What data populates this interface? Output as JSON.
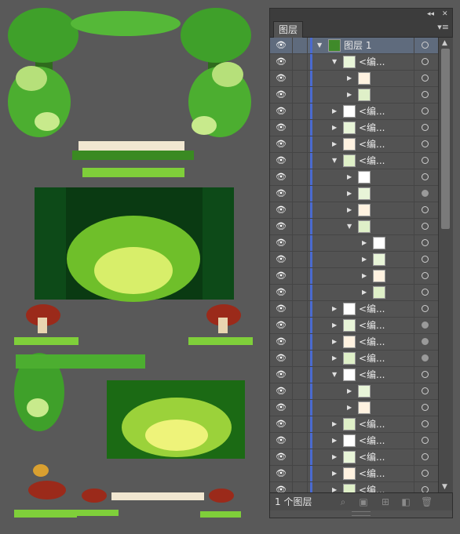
{
  "panel": {
    "collapse_icon": "double-chevron-left-icon",
    "close_icon": "close-icon",
    "tab_label": "图层",
    "menu_icon": "panel-menu-icon",
    "layer_count": "1 个图层",
    "footer_icons": [
      "locate-object-icon",
      "make-clipping-mask-icon",
      "create-sublayer-icon",
      "new-layer-icon",
      "delete-icon"
    ]
  },
  "layers": [
    {
      "label": "图层 1",
      "level": 0,
      "expanded": true,
      "circle": "open",
      "selected": true
    },
    {
      "label": "<编...",
      "level": 1,
      "expanded": true,
      "circle": "open"
    },
    {
      "label": "",
      "level": 2,
      "expanded": false,
      "circle": "open"
    },
    {
      "label": "",
      "level": 2,
      "expanded": false,
      "circle": "open"
    },
    {
      "label": "<编...",
      "level": 1,
      "expanded": false,
      "circle": "open"
    },
    {
      "label": "<编...",
      "level": 1,
      "expanded": false,
      "circle": "open"
    },
    {
      "label": "<编...",
      "level": 1,
      "expanded": false,
      "circle": "open"
    },
    {
      "label": "<编...",
      "level": 1,
      "expanded": true,
      "circle": "open"
    },
    {
      "label": "",
      "level": 2,
      "expanded": false,
      "circle": "open"
    },
    {
      "label": "",
      "level": 2,
      "expanded": false,
      "circle": "filled"
    },
    {
      "label": "",
      "level": 2,
      "expanded": false,
      "circle": "open"
    },
    {
      "label": "",
      "level": 2,
      "expanded": true,
      "circle": "open"
    },
    {
      "label": "",
      "level": 3,
      "expanded": false,
      "circle": "open"
    },
    {
      "label": "",
      "level": 3,
      "expanded": false,
      "circle": "open"
    },
    {
      "label": "",
      "level": 3,
      "expanded": false,
      "circle": "open"
    },
    {
      "label": "",
      "level": 3,
      "expanded": false,
      "circle": "open"
    },
    {
      "label": "<编...",
      "level": 1,
      "expanded": false,
      "circle": "open"
    },
    {
      "label": "<编...",
      "level": 1,
      "expanded": false,
      "circle": "filled"
    },
    {
      "label": "<编...",
      "level": 1,
      "expanded": false,
      "circle": "filled"
    },
    {
      "label": "<编...",
      "level": 1,
      "expanded": false,
      "circle": "filled"
    },
    {
      "label": "<编...",
      "level": 1,
      "expanded": true,
      "circle": "open"
    },
    {
      "label": "",
      "level": 2,
      "expanded": false,
      "circle": "open"
    },
    {
      "label": "",
      "level": 2,
      "expanded": false,
      "circle": "open"
    },
    {
      "label": "<编...",
      "level": 1,
      "expanded": false,
      "circle": "open"
    },
    {
      "label": "<编...",
      "level": 1,
      "expanded": false,
      "circle": "open"
    },
    {
      "label": "<编...",
      "level": 1,
      "expanded": false,
      "circle": "open"
    },
    {
      "label": "<编...",
      "level": 1,
      "expanded": false,
      "circle": "open"
    },
    {
      "label": "<编...",
      "level": 1,
      "expanded": false,
      "circle": "open"
    }
  ],
  "colors": {
    "selection": "#5f6b7d",
    "layer_color_bar": "#4a6ad0",
    "canvas": "#595959"
  }
}
